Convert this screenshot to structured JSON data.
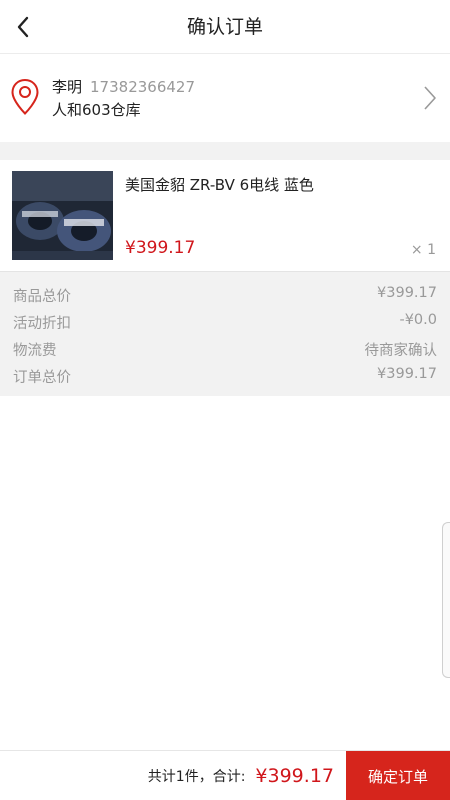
{
  "header": {
    "title": "确认订单",
    "back_icon": "chevron-left-icon"
  },
  "address": {
    "name": "李明",
    "phone": "17382366427",
    "detail": "人和603仓库",
    "icon": "location-pin-icon",
    "arrow_icon": "chevron-right-icon"
  },
  "product": {
    "name": "美国金貂 ZR-BV 6电线   蓝色",
    "price": "¥399.17",
    "quantity": "× 1",
    "image": "cable-coil-photo"
  },
  "summary": {
    "rows": [
      {
        "label": "商品总价",
        "value": "¥399.17"
      },
      {
        "label": "活动折扣",
        "value": "-¥0.0"
      },
      {
        "label": "物流费",
        "value": "待商家确认"
      },
      {
        "label": "订单总价",
        "value": "¥399.17"
      }
    ]
  },
  "footer": {
    "total_prefix": "共计1件，合计:",
    "total_amount": "¥399.17",
    "confirm_label": "确定订单"
  },
  "colors": {
    "accent": "#d6251c",
    "price": "#d0161b",
    "muted": "#999999",
    "background_gray": "#f2f2f2"
  }
}
